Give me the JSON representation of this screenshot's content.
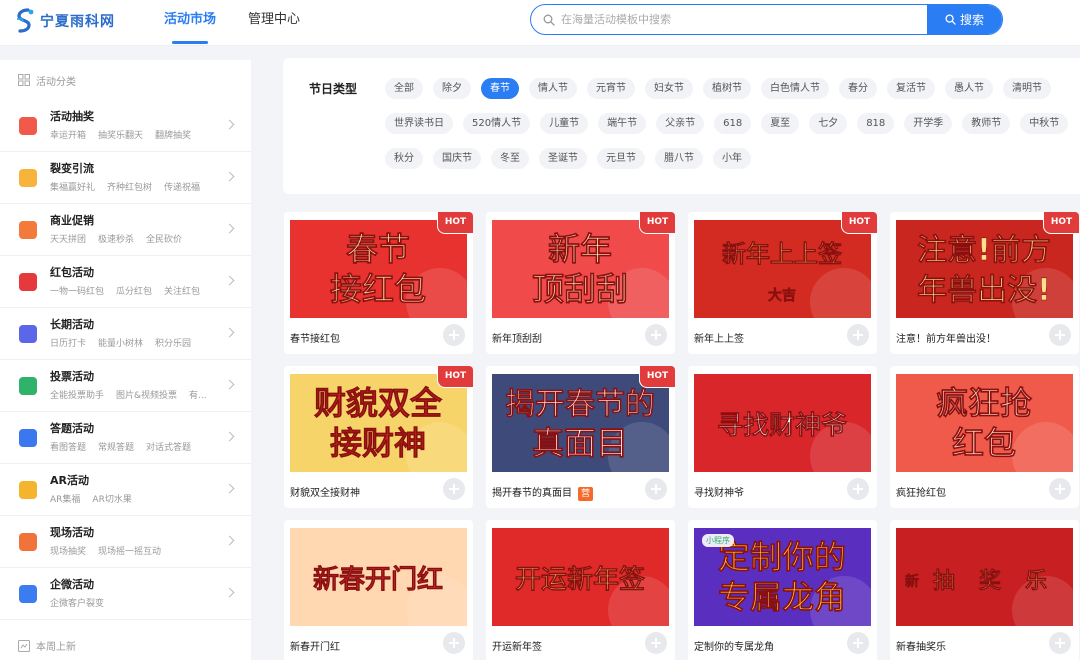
{
  "header": {
    "logo_text": "宁夏雨科网",
    "nav": [
      "活动市场",
      "管理中心"
    ],
    "search_placeholder": "在海量活动模板中搜索",
    "search_button": "搜索"
  },
  "sidebar": {
    "heading": "活动分类",
    "items": [
      {
        "title": "活动抽奖",
        "subs": [
          "幸运开箱",
          "抽奖乐翻天",
          "翻牌抽奖"
        ],
        "color": "#f15a4a"
      },
      {
        "title": "裂变引流",
        "subs": [
          "集福赢好礼",
          "齐种红包树",
          "传递祝福"
        ],
        "color": "#f7b33b"
      },
      {
        "title": "商业促销",
        "subs": [
          "天天拼团",
          "极速秒杀",
          "全民砍价"
        ],
        "color": "#f27a3a"
      },
      {
        "title": "红包活动",
        "subs": [
          "一物一码红包",
          "瓜分红包",
          "关注红包"
        ],
        "color": "#e5393b"
      },
      {
        "title": "长期活动",
        "subs": [
          "日历打卡",
          "能量小树林",
          "积分乐园"
        ],
        "color": "#5b66e8"
      },
      {
        "title": "投票活动",
        "subs": [
          "全能投票助手",
          "图片&视频投票",
          "有..."
        ],
        "color": "#2fb36a"
      },
      {
        "title": "答题活动",
        "subs": [
          "看图答题",
          "常规答题",
          "对话式答题"
        ],
        "color": "#3b78f0"
      },
      {
        "title": "AR活动",
        "subs": [
          "AR集福",
          "AR切水果"
        ],
        "color": "#f4b42e"
      },
      {
        "title": "现场活动",
        "subs": [
          "现场抽奖",
          "现场摇一摇互动"
        ],
        "color": "#f2733a"
      },
      {
        "title": "企微活动",
        "subs": [
          "企微客户裂变"
        ],
        "color": "#3b7cf0"
      }
    ],
    "footer": "本周上新"
  },
  "filter": {
    "label": "节日类型",
    "tags": [
      "全部",
      "除夕",
      "春节",
      "情人节",
      "元宵节",
      "妇女节",
      "植树节",
      "白色情人节",
      "春分",
      "复活节",
      "愚人节",
      "清明节",
      "世界读书日",
      "520情人节",
      "儿童节",
      "端午节",
      "父亲节",
      "618",
      "夏至",
      "七夕",
      "818",
      "开学季",
      "教师节",
      "中秋节",
      "秋分",
      "国庆节",
      "冬至",
      "圣诞节",
      "元旦节",
      "腊八节",
      "小年"
    ],
    "active": "春节"
  },
  "cards": [
    {
      "title": "春节接红包",
      "hot": true,
      "art": [
        "春节",
        "接红包"
      ],
      "bg": "#e8322f",
      "ink": "#ffe7a8"
    },
    {
      "title": "新年顶刮刮",
      "hot": true,
      "art": [
        "新年",
        "顶刮刮"
      ],
      "bg": "#f04a4a",
      "ink": "#fff3c4"
    },
    {
      "title": "新年上上签",
      "hot": true,
      "art": [
        "新年上上签",
        "大吉"
      ],
      "bg": "#d32b22",
      "ink": "#ffd36a"
    },
    {
      "title": "注意！前方年兽出没！",
      "hot": true,
      "art": [
        "注意!前方",
        "年兽出没!"
      ],
      "bg": "#c9261f",
      "ink": "#ffe08a"
    },
    {
      "title": "财貌双全接财神",
      "hot": true,
      "art": [
        "财貌双全",
        "接财神"
      ],
      "bg": "#f7d46a",
      "ink": "#c2261e"
    },
    {
      "title": "揭开春节的真面目",
      "hot": true,
      "badge": "营",
      "art": [
        "揭开春节的",
        "真面目"
      ],
      "bg": "#3e4a7a",
      "ink": "#ffffff"
    },
    {
      "title": "寻找财神爷",
      "hot": false,
      "art": [
        "寻找财神爷"
      ],
      "bg": "#d9262b",
      "ink": "#ffffff"
    },
    {
      "title": "疯狂抢红包",
      "hot": false,
      "art": [
        "疯狂抢",
        "红包"
      ],
      "bg": "#f05a4a",
      "ink": "#ffe3cc"
    },
    {
      "title": "新春开门红",
      "hot": false,
      "art": [
        "新春开门红"
      ],
      "bg": "#ffd7b0",
      "ink": "#e0333a"
    },
    {
      "title": "开运新年签",
      "hot": false,
      "art": [
        "开运新年签"
      ],
      "bg": "#e02a2a",
      "ink": "#ffd86a"
    },
    {
      "title": "定制你的专属龙角",
      "hot": false,
      "art": [
        "定制你的",
        "专属龙角"
      ],
      "mini": "小程序",
      "bg": "#5a2fc0",
      "ink": "#ffd24a"
    },
    {
      "title": "新春抽奖乐",
      "hot": false,
      "art": [
        "新",
        "抽",
        "奖",
        "乐"
      ],
      "bg": "#c81f22",
      "ink": "#ffe07a"
    }
  ]
}
